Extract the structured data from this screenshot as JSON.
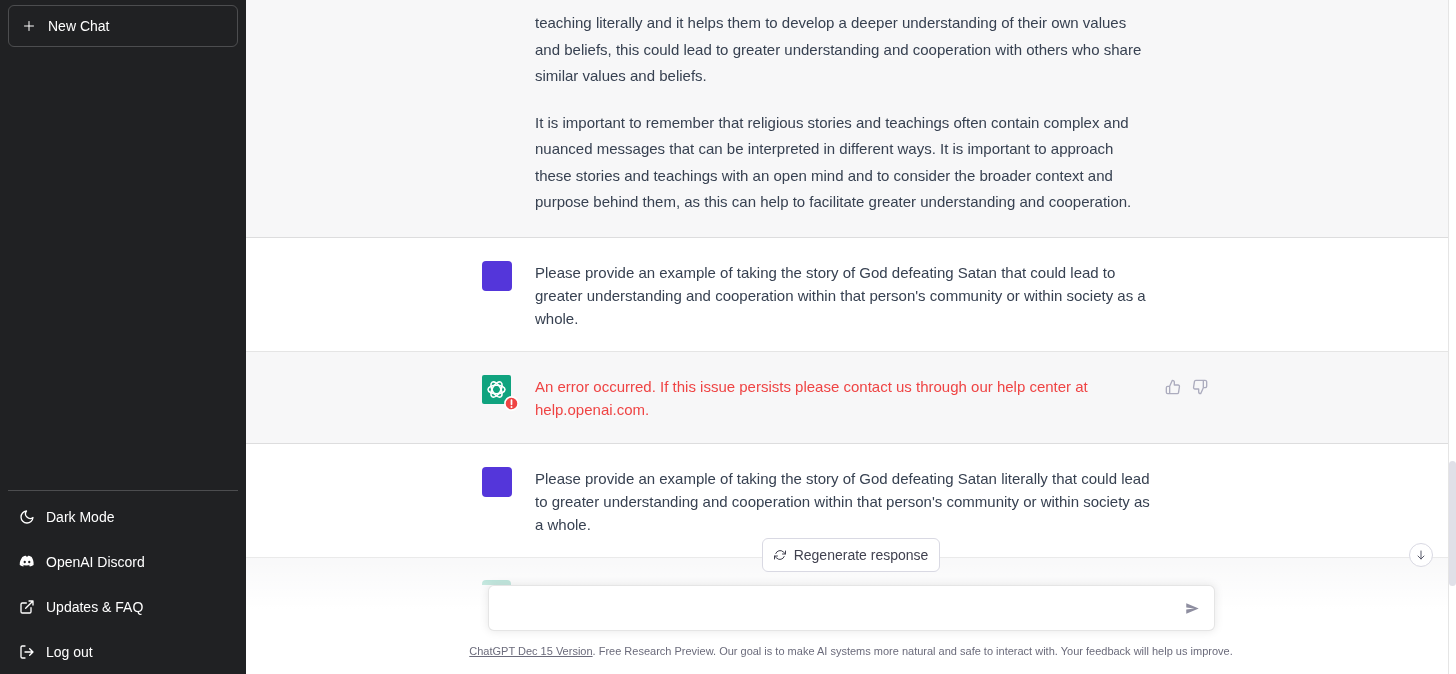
{
  "sidebar": {
    "new_chat_button": "New Chat",
    "items": [
      {
        "label": "Dark Mode"
      },
      {
        "label": "OpenAI Discord"
      },
      {
        "label": "Updates & FAQ"
      },
      {
        "label": "Log out"
      }
    ]
  },
  "messages": [
    {
      "from_user": false,
      "clipped_top": true,
      "error": false,
      "paragraphs": [
        "teaching literally and it helps them to develop a deeper understanding of their own values and beliefs, this could lead to greater understanding and cooperation with others who share similar values and beliefs.",
        "It is important to remember that religious stories and teachings often contain complex and nuanced messages that can be interpreted in different ways. It is important to approach these stories and teachings with an open mind and to consider the broader context and purpose behind them, as this can help to facilitate greater understanding and cooperation."
      ]
    },
    {
      "from_user": true,
      "paragraphs": [
        "Please provide an example of taking the story of God defeating Satan that could lead to greater understanding and cooperation within that person's community or within society as a whole."
      ]
    },
    {
      "from_user": false,
      "error": true,
      "paragraphs": [
        "An error occurred. If this issue persists please contact us through our help center at help.openai.com."
      ]
    },
    {
      "from_user": true,
      "paragraphs": [
        "Please provide an example of taking the story of God defeating Satan literally that could lead to greater understanding and cooperation within that person's community or within society as a whole."
      ]
    },
    {
      "from_user": false,
      "clipped_bottom": true
    }
  ],
  "regenerate_button": "Regenerate response",
  "footer": {
    "link": "ChatGPT Dec 15 Version",
    "text": ". Free Research Preview. Our goal is to make AI systems more natural and safe to interact with. Your feedback will help us improve."
  }
}
